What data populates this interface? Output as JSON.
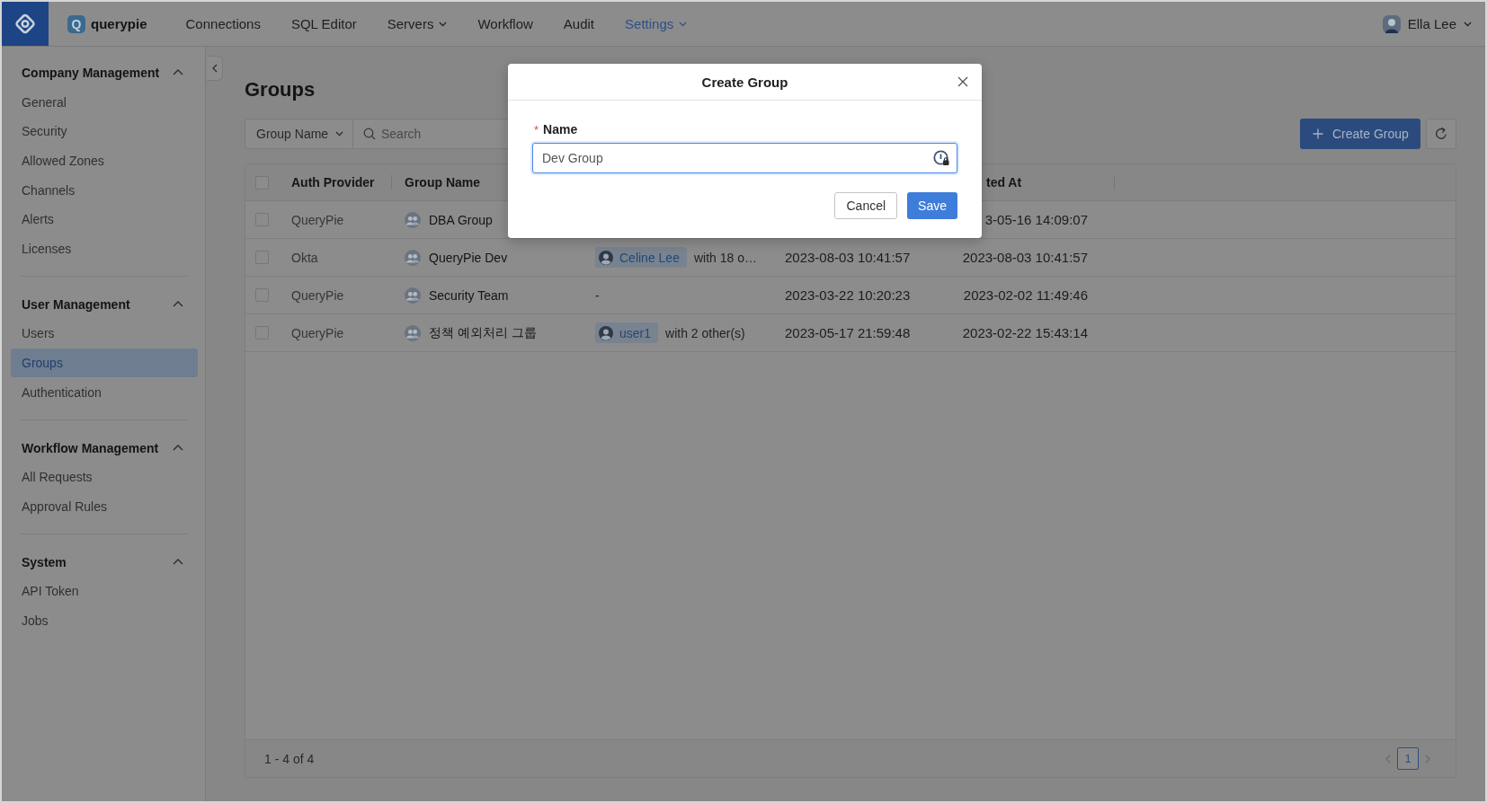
{
  "top_bar": {
    "logo": {
      "mark": "Q",
      "name": "querypie"
    },
    "nav": [
      {
        "label": "Connections",
        "selected": false,
        "dropdown": false
      },
      {
        "label": "SQL Editor",
        "selected": false,
        "dropdown": false
      },
      {
        "label": "Servers",
        "selected": false,
        "dropdown": true
      },
      {
        "label": "Workflow",
        "selected": false,
        "dropdown": false
      },
      {
        "label": "Audit",
        "selected": false,
        "dropdown": false
      },
      {
        "label": "Settings",
        "selected": true,
        "dropdown": true
      }
    ],
    "user": {
      "name": "Ella Lee"
    }
  },
  "sidebar": {
    "sections": [
      {
        "title": "Company Management",
        "expanded": true,
        "items": [
          {
            "label": "General",
            "selected": false
          },
          {
            "label": "Security",
            "selected": false
          },
          {
            "label": "Allowed Zones",
            "selected": false
          },
          {
            "label": "Channels",
            "selected": false
          },
          {
            "label": "Alerts",
            "selected": false
          },
          {
            "label": "Licenses",
            "selected": false
          }
        ]
      },
      {
        "title": "User Management",
        "expanded": true,
        "items": [
          {
            "label": "Users",
            "selected": false
          },
          {
            "label": "Groups",
            "selected": true
          },
          {
            "label": "Authentication",
            "selected": false
          }
        ]
      },
      {
        "title": "Workflow Management",
        "expanded": true,
        "items": [
          {
            "label": "All Requests",
            "selected": false
          },
          {
            "label": "Approval Rules",
            "selected": false
          }
        ]
      },
      {
        "title": "System",
        "expanded": true,
        "items": [
          {
            "label": "API Token",
            "selected": false
          },
          {
            "label": "Jobs",
            "selected": false
          }
        ]
      }
    ]
  },
  "page": {
    "title": "Groups",
    "filter": {
      "value": "Group Name"
    },
    "search": {
      "placeholder": "Search"
    },
    "create_button": "Create Group"
  },
  "table": {
    "select_all": {
      "checked": false
    },
    "columns": {
      "auth_provider": "Auth Provider",
      "group_name": "Group Name",
      "column_5": "ted At"
    },
    "rows": [
      {
        "checked": false,
        "auth_provider": "QueryPie",
        "group_name": "DBA Group",
        "column_5": "3-05-16 14:09:07"
      },
      {
        "checked": false,
        "auth_provider": "Okta",
        "group_name": "QueryPie Dev",
        "column_3": {
          "member": "Celine Lee",
          "others": "with 18 o…"
        },
        "column_4": "2023-08-03 10:41:57",
        "column_5": "2023-08-03 10:41:57"
      },
      {
        "checked": false,
        "auth_provider": "QueryPie",
        "group_name": "Security Team",
        "column_3": {
          "text": "-"
        },
        "column_4": "2023-03-22 10:20:23",
        "column_5": "2023-02-02 11:49:46"
      },
      {
        "checked": false,
        "auth_provider": "QueryPie",
        "group_name": "정책 예외처리 그룹",
        "column_3": {
          "member": "user1",
          "others": "with 2 other(s)"
        },
        "column_4": "2023-05-17 21:59:48",
        "column_5": "2023-02-22 15:43:14"
      }
    ],
    "footer": {
      "range": "1 - 4 of 4",
      "prev": {
        "disabled": true
      },
      "pages": [
        {
          "label": "1",
          "selected": true
        }
      ],
      "next": {
        "disabled": true
      }
    }
  },
  "modal": {
    "title": "Create Group",
    "field": {
      "label": "Name",
      "required_mark": "*",
      "value": "Dev Group",
      "focused": true
    },
    "buttons": [
      {
        "label": "Cancel",
        "kind": "secondary"
      },
      {
        "label": "Save",
        "kind": "primary"
      }
    ]
  }
}
